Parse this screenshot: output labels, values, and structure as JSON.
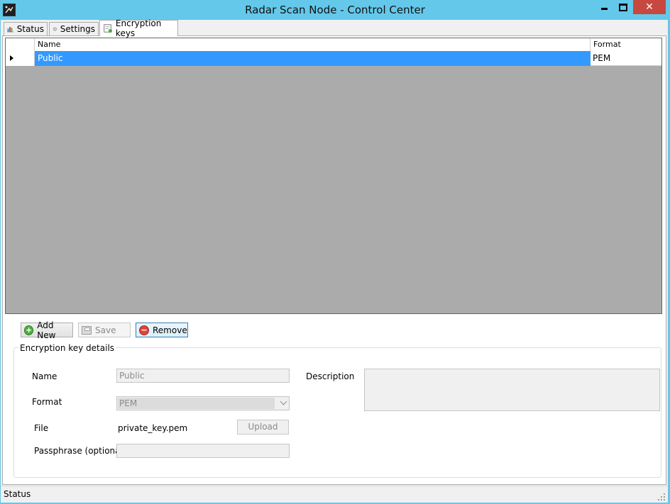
{
  "window": {
    "title": "Radar Scan Node - Control Center",
    "close_glyph": "✕"
  },
  "tabs": [
    {
      "label": "Status",
      "icon": "bar-chart-icon",
      "active": false
    },
    {
      "label": "Settings",
      "icon": "gear-icon",
      "active": false
    },
    {
      "label": "Encryption keys",
      "icon": "key-document-icon",
      "active": true
    }
  ],
  "grid": {
    "columns": [
      "Name",
      "Format"
    ],
    "rows": [
      {
        "name": "Public",
        "format": "PEM",
        "selected": true
      }
    ]
  },
  "actions": {
    "add_label": "Add New",
    "save_label": "Save",
    "remove_label": "Remove"
  },
  "details": {
    "group_title": "Encryption key details",
    "name_label": "Name",
    "name_value": "Public",
    "format_label": "Format",
    "format_value": "PEM",
    "file_label": "File",
    "file_value": "private_key.pem",
    "upload_label": "Upload",
    "passphrase_label": "Passphrase (optional)",
    "passphrase_value": "",
    "description_label": "Description",
    "description_value": ""
  },
  "statusbar": {
    "text": "Status"
  },
  "colors": {
    "titlebar": "#64c8ea",
    "selection": "#3399ff",
    "close_button": "#c7483f",
    "grid_background": "#ababab"
  }
}
